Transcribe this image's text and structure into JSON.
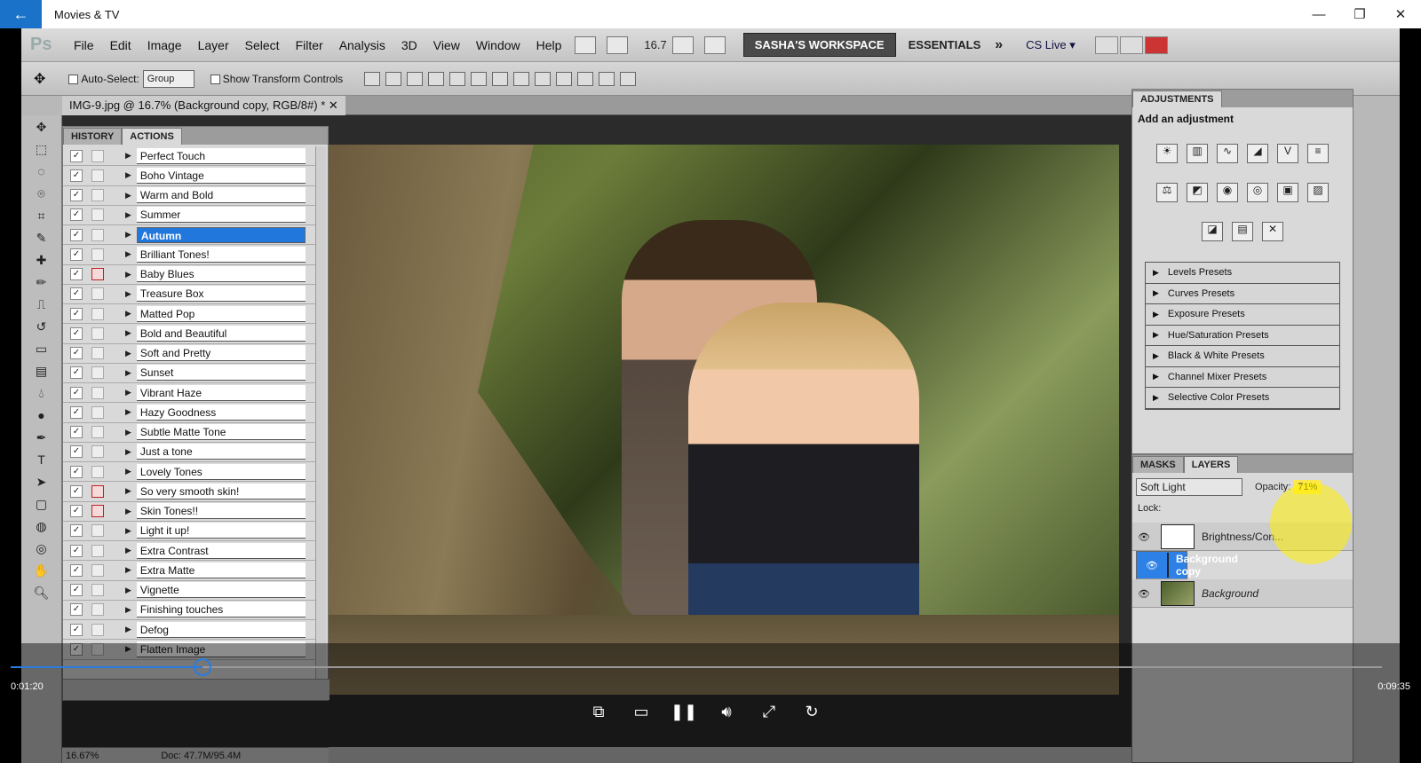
{
  "window": {
    "title": "Movies & TV",
    "back": "←",
    "minimize": "—",
    "restore": "❐",
    "close": "✕"
  },
  "ps_menu": {
    "logo": "Ps",
    "items": [
      "File",
      "Edit",
      "Image",
      "Layer",
      "Select",
      "Filter",
      "Analysis",
      "3D",
      "View",
      "Window",
      "Help"
    ],
    "zoom": "16.7",
    "workspace": "SASHA'S WORKSPACE",
    "essentials": "ESSENTIALS",
    "more": "»",
    "cslive": "CS Live ▾"
  },
  "options": {
    "auto_select": "Auto-Select:",
    "group": "Group",
    "transform": "Show Transform Controls"
  },
  "doc_tab": {
    "label": "IMG-9.jpg @ 16.7% (Background copy, RGB/8#) *",
    "close": "✕"
  },
  "actions_panel": {
    "tabs": [
      "HISTORY",
      "ACTIONS"
    ],
    "rows": [
      {
        "label": "Perfect Touch",
        "modal": false,
        "selected": false
      },
      {
        "label": "Boho Vintage",
        "modal": false,
        "selected": false
      },
      {
        "label": "Warm and Bold",
        "modal": false,
        "selected": false
      },
      {
        "label": "Summer",
        "modal": false,
        "selected": false
      },
      {
        "label": "Autumn",
        "modal": false,
        "selected": true
      },
      {
        "label": "Brilliant Tones!",
        "modal": false,
        "selected": false
      },
      {
        "label": "Baby Blues",
        "modal": true,
        "selected": false
      },
      {
        "label": "Treasure Box",
        "modal": false,
        "selected": false
      },
      {
        "label": "Matted Pop",
        "modal": false,
        "selected": false
      },
      {
        "label": "Bold and Beautiful",
        "modal": false,
        "selected": false
      },
      {
        "label": "Soft and Pretty",
        "modal": false,
        "selected": false
      },
      {
        "label": "Sunset",
        "modal": false,
        "selected": false
      },
      {
        "label": "Vibrant Haze",
        "modal": false,
        "selected": false
      },
      {
        "label": "Hazy Goodness",
        "modal": false,
        "selected": false
      },
      {
        "label": "Subtle Matte Tone",
        "modal": false,
        "selected": false
      },
      {
        "label": "Just a tone",
        "modal": false,
        "selected": false
      },
      {
        "label": "Lovely Tones",
        "modal": false,
        "selected": false
      },
      {
        "label": "So very smooth skin!",
        "modal": true,
        "selected": false
      },
      {
        "label": "Skin Tones!!",
        "modal": true,
        "selected": false
      },
      {
        "label": "Light it up!",
        "modal": false,
        "selected": false
      },
      {
        "label": "Extra Contrast",
        "modal": false,
        "selected": false
      },
      {
        "label": "Extra Matte",
        "modal": false,
        "selected": false
      },
      {
        "label": "Vignette",
        "modal": false,
        "selected": false
      },
      {
        "label": "Finishing touches",
        "modal": false,
        "selected": false
      },
      {
        "label": "Defog",
        "modal": false,
        "selected": false
      },
      {
        "label": "Flatten Image",
        "modal": false,
        "selected": false
      }
    ]
  },
  "adjustments": {
    "tab": "ADJUSTMENTS",
    "subtitle": "Add an adjustment",
    "presets": [
      "Levels Presets",
      "Curves Presets",
      "Exposure Presets",
      "Hue/Saturation Presets",
      "Black & White Presets",
      "Channel Mixer Presets",
      "Selective Color Presets"
    ]
  },
  "layers": {
    "tabs": [
      "MASKS",
      "LAYERS"
    ],
    "blend_mode": "Soft Light",
    "opacity_label": "Opacity:",
    "opacity_value": "71%",
    "lock_label": "Lock:",
    "rows": [
      {
        "name": "Brightness/Con...",
        "selected": false
      },
      {
        "name": "Background copy",
        "selected": true
      },
      {
        "name": "Background",
        "selected": false
      }
    ]
  },
  "status": {
    "zoom": "16.67%",
    "doc": "Doc: 47.7M/95.4M"
  },
  "player": {
    "elapsed": "0:01:20",
    "total": "0:09:35",
    "progress_fraction": 0.14
  }
}
